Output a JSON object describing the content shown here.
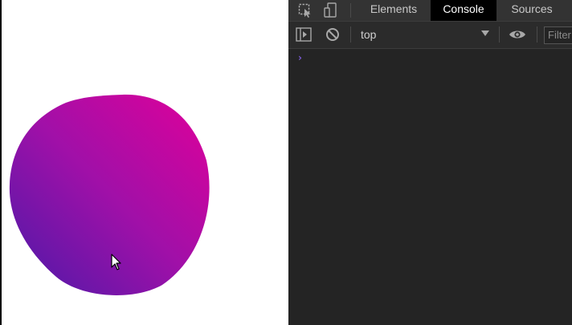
{
  "devtools": {
    "tabs": [
      {
        "label": "Elements",
        "active": false
      },
      {
        "label": "Console",
        "active": true
      },
      {
        "label": "Sources",
        "active": false
      }
    ],
    "toolbar": {
      "context_value": "top",
      "filter_placeholder": "Filter"
    },
    "console": {
      "prompt_symbol": "›"
    },
    "icons": {
      "inspect": "inspect-element-icon",
      "device": "device-toolbar-icon",
      "sidebar": "console-sidebar-icon",
      "clear": "clear-console-icon",
      "dropdown": "chevron-down-icon",
      "eye": "live-expression-eye-icon",
      "cursor": "mouse-pointer-icon"
    }
  },
  "colors": {
    "blob_gradient_start": "#4a1aa8",
    "blob_gradient_mid": "#a010a8",
    "blob_gradient_end": "#e0009a",
    "devtools_background": "#242424",
    "tab_active_background": "#000000",
    "prompt": "#7b5bd6"
  }
}
